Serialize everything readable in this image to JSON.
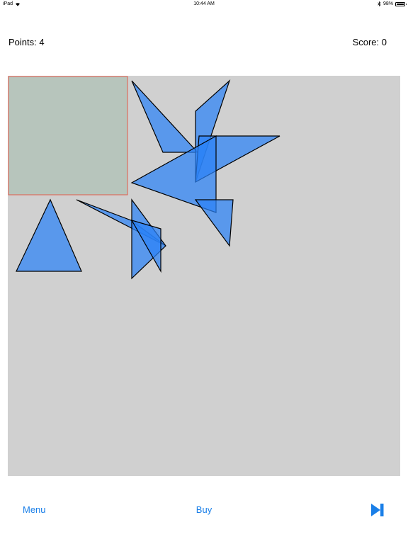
{
  "status_bar": {
    "device": "iPad",
    "wifi_icon": "wifi-icon",
    "time": "10:44 AM",
    "bluetooth_icon": "bluetooth-icon",
    "battery_percent": "98%",
    "battery_level": 0.98
  },
  "header": {
    "points_label": "Points:",
    "points_value": "4",
    "score_label": "Score:",
    "score_value": "0"
  },
  "board": {
    "background": "#d0d0d0",
    "target_fill": "#b7c5bc",
    "target_stroke": "#e05a4a",
    "piece_fill": "#2b82f6",
    "piece_stroke": "#000000"
  },
  "bottom_bar": {
    "menu_label": "Menu",
    "buy_label": "Buy",
    "next_icon": "skip-forward-icon",
    "accent": "#1a7fe8"
  }
}
